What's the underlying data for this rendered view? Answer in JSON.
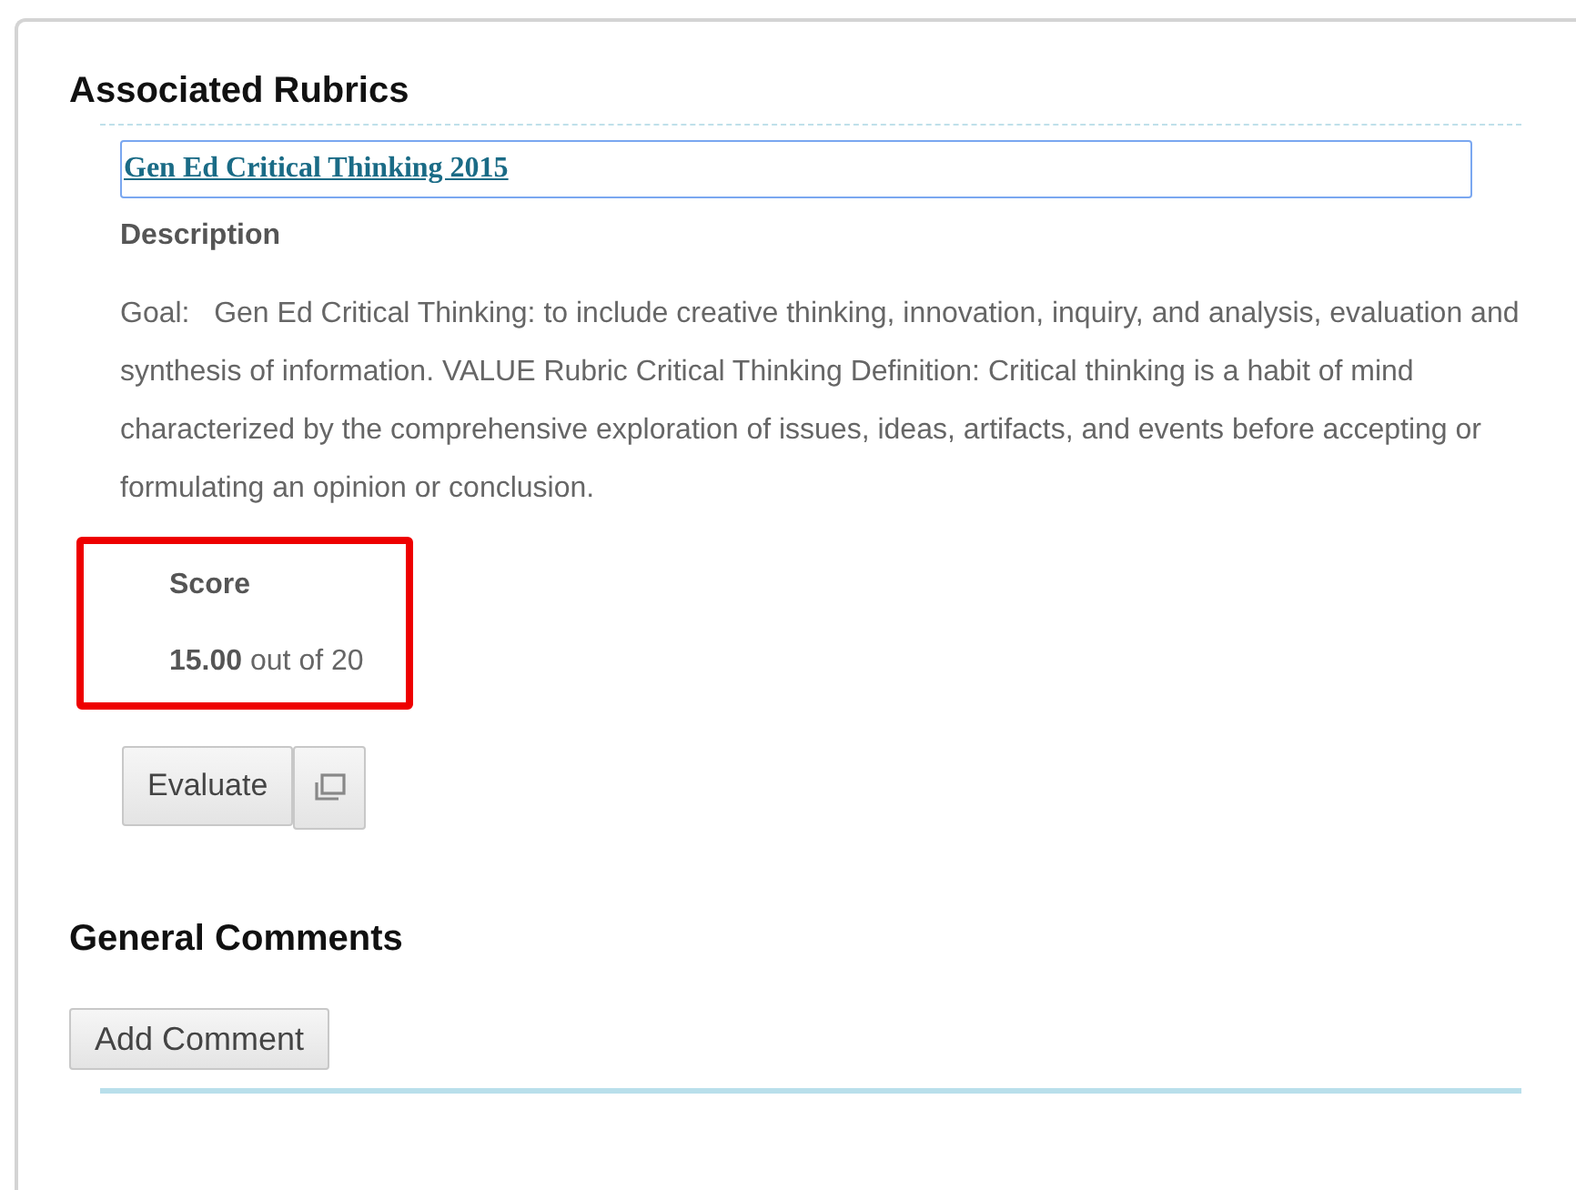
{
  "rubrics_section": {
    "title": "Associated Rubrics",
    "rubric_link": "Gen Ed Critical Thinking 2015",
    "description_label": "Description",
    "description": "Goal:   Gen Ed Critical Thinking: to include creative thinking, innovation, inquiry, and analysis, evaluation and synthesis of information. VALUE Rubric Critical Thinking Definition: Critical thinking is a habit of mind characterized by the comprehensive exploration of issues, ideas, artifacts, and events before accepting or formulating an opinion or conclusion.",
    "score": {
      "label": "Score",
      "value": "15.00",
      "out_of": "out of 20",
      "highlighted": true
    },
    "evaluate_button": "Evaluate"
  },
  "comments_section": {
    "title": "General Comments",
    "add_button": "Add Comment"
  }
}
